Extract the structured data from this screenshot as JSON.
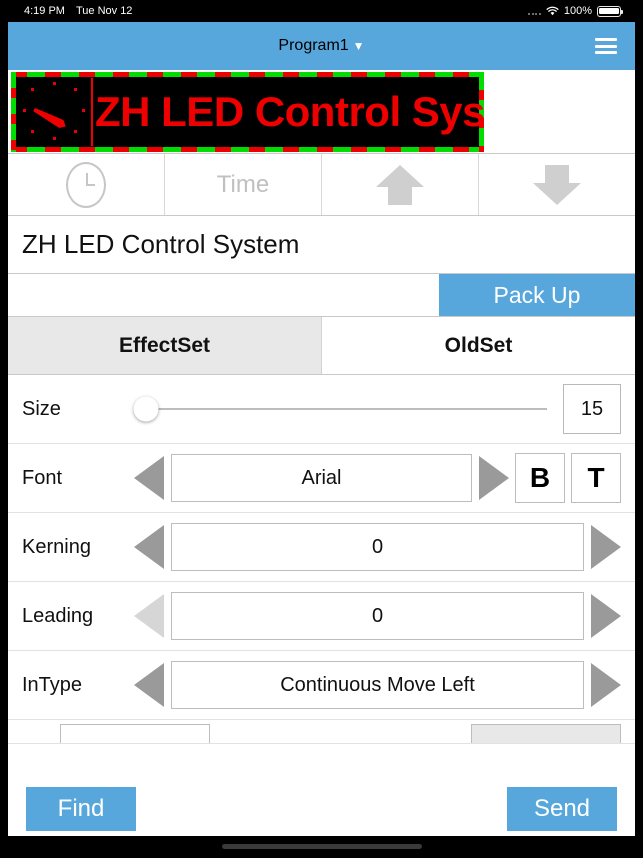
{
  "statusbar": {
    "time": "4:19 PM",
    "date": "Tue Nov 12",
    "battery_percent": "100%",
    "wifi_icon": "wifi-icon",
    "battery_icon": "battery-icon"
  },
  "header": {
    "title": "Program1",
    "caret": "▼",
    "menu_icon": "hamburger-menu-icon",
    "accent_color": "#57a7dd"
  },
  "led_preview": {
    "text": "ZH LED Control System",
    "text_color": "#ee0000",
    "background_color": "#000000",
    "border_colors": [
      "#ee0000",
      "#00dd00"
    ],
    "clock_icon": "analog-clock-icon"
  },
  "toolbar": {
    "clock_icon": "clock-icon",
    "time_label": "Time",
    "up_icon": "arrow-up-icon",
    "down_icon": "arrow-down-icon"
  },
  "text_display": {
    "value": "ZH LED Control System"
  },
  "packup": {
    "label": "Pack Up"
  },
  "tabs": [
    {
      "label": "EffectSet",
      "active": true
    },
    {
      "label": "OldSet",
      "active": false
    }
  ],
  "settings": {
    "size": {
      "label": "Size",
      "value": "15",
      "slider_percent": 3,
      "fill_color": "#2f7df6"
    },
    "font": {
      "label": "Font",
      "value": "Arial",
      "prev_icon": "triangle-left-icon",
      "next_icon": "triangle-right-icon",
      "bold_label": "B",
      "text_label": "T"
    },
    "kerning": {
      "label": "Kerning",
      "value": "0",
      "prev_icon": "triangle-left-icon",
      "next_icon": "triangle-right-icon"
    },
    "leading": {
      "label": "Leading",
      "value": "0",
      "prev_icon": "triangle-left-icon",
      "next_icon": "triangle-right-icon"
    },
    "intype": {
      "label": "InType",
      "value": "Continuous Move Left",
      "prev_icon": "triangle-left-icon",
      "next_icon": "triangle-right-icon"
    }
  },
  "bottombar": {
    "find_label": "Find",
    "send_label": "Send"
  }
}
